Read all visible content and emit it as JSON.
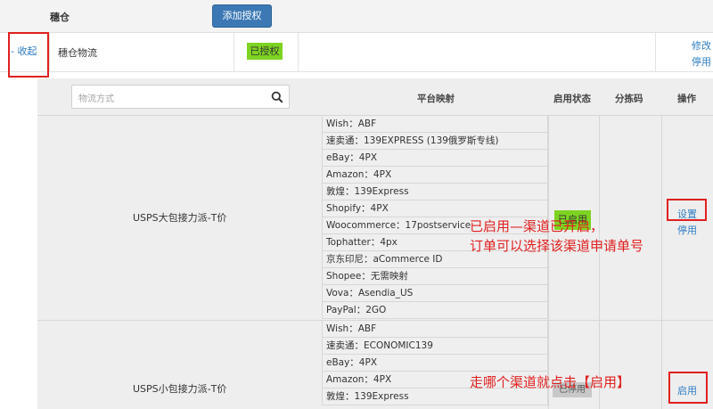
{
  "header": {
    "title": "穗仓",
    "add_button": "添加授权"
  },
  "provider_row": {
    "collapse_label": "- 收起",
    "name": "穗仓物流",
    "status": "已授权",
    "actions": {
      "edit": "修改",
      "disable": "停用"
    }
  },
  "panel": {
    "search_placeholder": "物流方式",
    "columns": {
      "mapping": "平台映射",
      "status": "启用状态",
      "sort_code": "分拣码",
      "actions": "操作"
    }
  },
  "methods": [
    {
      "name": "USPS大包接力派-T价",
      "status_label": "已启用",
      "actions": {
        "settings": "设置",
        "disable": "停用"
      },
      "mappings": [
        "Wish：ABF",
        "速卖通：139EXPRESS (139俄罗斯专线)",
        "eBay：4PX",
        "Amazon：4PX",
        "敦煌：139Express",
        "Shopify：4PX",
        "Woocommerce：17postservice",
        "Tophatter：4px",
        "京东印尼：aCommerce ID",
        "Shopee：无需映射",
        "Vova：Asendia_US",
        "PayPal：2GO"
      ]
    },
    {
      "name": "USPS小包接力派-T价",
      "status_label": "已停用",
      "actions": {
        "enable": "启用"
      },
      "mappings": [
        "Wish：ABF",
        "速卖通：ECONOMIC139",
        "eBay：4PX",
        "Amazon：4PX",
        "敦煌：139Express"
      ]
    }
  ],
  "annotations": {
    "enabled_note_line1": "已启用—渠道已开启，",
    "enabled_note_line2": "订单可以选择该渠道申请单号",
    "enable_note": "走哪个渠道就点击【启用】"
  },
  "colors": {
    "primary_button": "#3c79b4",
    "link": "#2e7dc2",
    "status_green": "#7ed321",
    "annotation_red": "#e02020"
  }
}
